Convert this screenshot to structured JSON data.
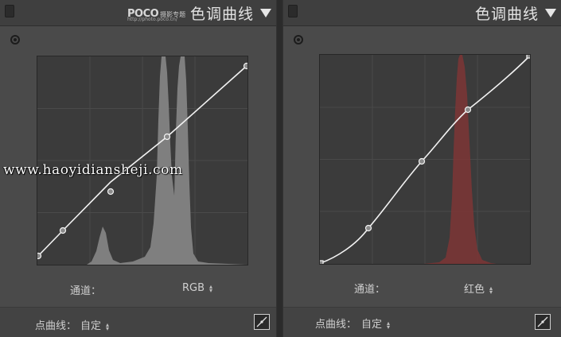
{
  "logo": {
    "main": "POCO",
    "sub": "摄影专题",
    "url": "http://photo.poco.cn/"
  },
  "watermark": "www.haoyidiansheji.com",
  "left_panel": {
    "title": "色调曲线",
    "channel_label": "通道：",
    "channel_value": "RGB",
    "point_curve_label": "点曲线：",
    "point_curve_value": "自定",
    "curve_points": [
      [
        0,
        0
      ],
      [
        0.12,
        0.13
      ],
      [
        0.35,
        0.36
      ],
      [
        0.62,
        0.6
      ],
      [
        1,
        0.93
      ]
    ]
  },
  "right_panel": {
    "title": "色调曲线",
    "channel_label": "通道：",
    "channel_value": "红色",
    "point_curve_label": "点曲线：",
    "point_curve_value": "自定",
    "curve_points": [
      [
        0,
        0
      ],
      [
        0.23,
        0.17
      ],
      [
        0.48,
        0.49
      ],
      [
        0.71,
        0.73
      ],
      [
        1,
        1
      ]
    ]
  },
  "colors": {
    "panel_bg": "#4a4a4a",
    "graph_bg": "#3b3b3b",
    "histogram_gray": "#7f7f7f",
    "histogram_red": "#7a3636",
    "curve": "#f2f2f2"
  }
}
